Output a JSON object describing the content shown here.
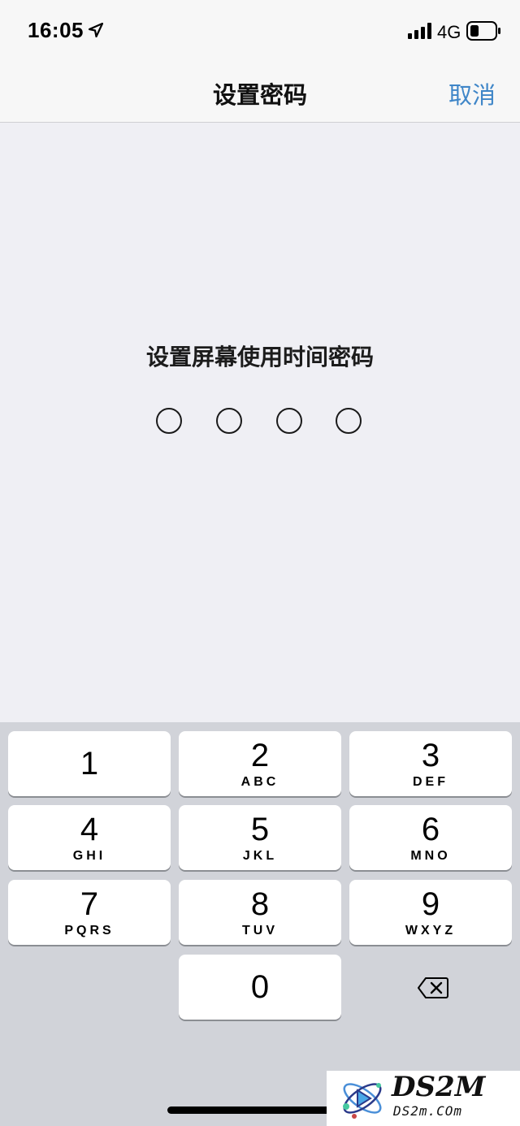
{
  "status_bar": {
    "time": "16:05",
    "network": "4G",
    "icons": [
      "location-arrow-icon",
      "signal-icon",
      "battery-icon"
    ]
  },
  "nav": {
    "title": "设置密码",
    "cancel_label": "取消"
  },
  "prompt": "设置屏幕使用时间密码",
  "passcode": {
    "length": 4,
    "entered": 0
  },
  "keypad": {
    "keys": [
      {
        "digit": "1",
        "letters": ""
      },
      {
        "digit": "2",
        "letters": "ABC"
      },
      {
        "digit": "3",
        "letters": "DEF"
      },
      {
        "digit": "4",
        "letters": "GHI"
      },
      {
        "digit": "5",
        "letters": "JKL"
      },
      {
        "digit": "6",
        "letters": "MNO"
      },
      {
        "digit": "7",
        "letters": "PQRS"
      },
      {
        "digit": "8",
        "letters": "TUV"
      },
      {
        "digit": "9",
        "letters": "WXYZ"
      },
      {
        "digit": "0",
        "letters": ""
      }
    ],
    "delete_icon": "backspace-icon"
  },
  "watermark": {
    "main": "DS2M",
    "sub": "DS2m.COm"
  },
  "colors": {
    "accent": "#3f86c8",
    "background": "#efeff4",
    "keypad_bg": "#d1d3d9"
  }
}
